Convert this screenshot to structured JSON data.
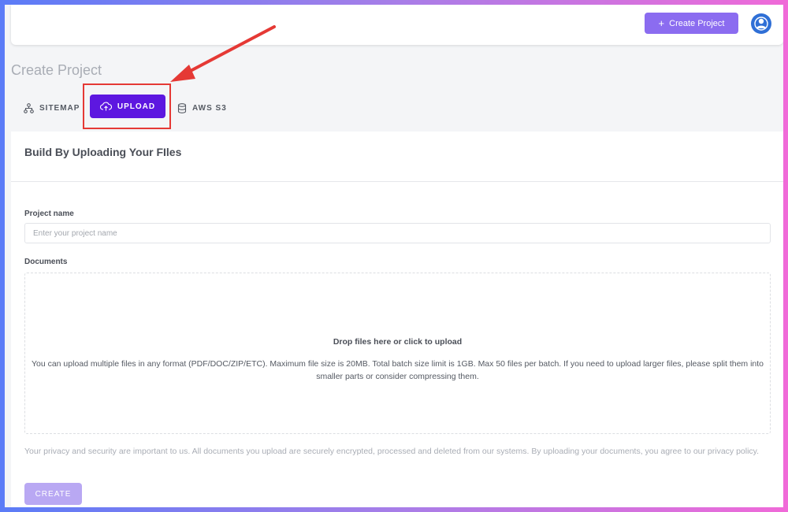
{
  "header": {
    "create_project_label": "Create Project",
    "create_project_icon": "plus-icon",
    "avatar_icon": "user-avatar-icon"
  },
  "page": {
    "title": "Create Project"
  },
  "tabs": [
    {
      "label": "SITEMAP",
      "icon": "sitemap-icon",
      "active": false
    },
    {
      "label": "UPLOAD",
      "icon": "cloud-upload-icon",
      "active": true
    },
    {
      "label": "AWS S3",
      "icon": "database-icon",
      "active": false
    }
  ],
  "form": {
    "heading": "Build By Uploading Your FIles",
    "project_name_label": "Project name",
    "project_name_placeholder": "Enter your project name",
    "project_name_value": "",
    "documents_label": "Documents",
    "dropzone_title": "Drop files here or click to upload",
    "dropzone_description": "You can upload multiple files in any format (PDF/DOC/ZIP/ETC). Maximum file size is 20MB. Total batch size limit is 1GB. Max 50 files per batch. If you need to upload larger files, please split them into smaller parts or consider compressing them.",
    "privacy_text": "Your privacy and security are important to us. All documents you upload are securely encrypted, processed and deleted from our systems. By uploading your documents, you agree to our privacy policy.",
    "submit_label": "CREATE"
  },
  "colors": {
    "accent": "#5d17e0",
    "button_light": "#8b6cf0",
    "highlight": "#e53935"
  }
}
